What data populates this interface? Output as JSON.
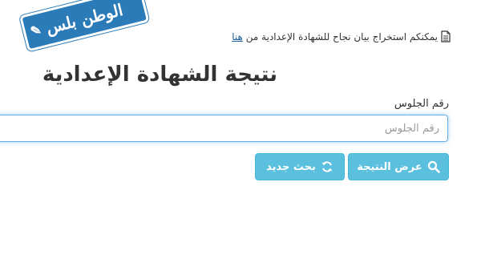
{
  "logo": {
    "text": "الوطن بلس",
    "color": "#2b7bb9"
  },
  "notice": {
    "text": "يمكنكم استخراج بيان نجاح للشهادة الإعدادية من",
    "link_label": "هنا",
    "icon": "document-icon"
  },
  "page": {
    "title": "نتيجة الشهادة الإعدادية"
  },
  "form": {
    "seat_label": "رقم الجلوس",
    "seat_placeholder": "رقم الجلوس",
    "seat_value": "",
    "show_result_label": "عرض النتيجة",
    "show_result_icon": "search-icon",
    "new_search_label": "بحث جديد",
    "new_search_icon": "refresh-icon"
  },
  "colors": {
    "button": "#5bc0de",
    "input_focus": "#66afe9",
    "link": "#1a5c99"
  }
}
